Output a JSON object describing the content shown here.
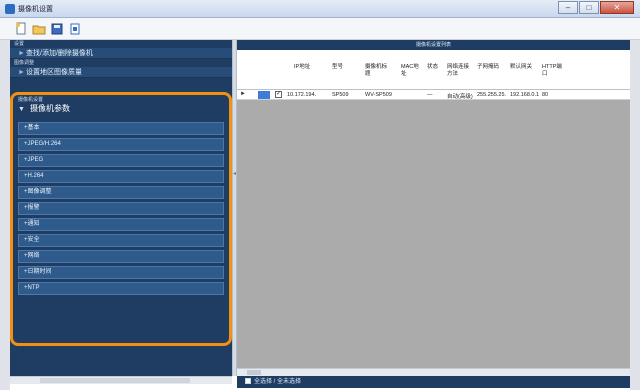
{
  "window": {
    "title": "摄像机设置",
    "min_glyph": "–",
    "max_glyph": "□",
    "close_glyph": "✕"
  },
  "toolbar": {
    "icons": [
      "new-icon",
      "open-icon",
      "save-icon",
      "export-icon"
    ]
  },
  "left": {
    "sections": [
      {
        "header": "设置",
        "row": "查找/添加/删除摄像机"
      },
      {
        "header": "图像调整",
        "row": "设置地区图像质量"
      }
    ],
    "camera_header": "摄像机设置",
    "camera_title": "摄像机参数",
    "params": [
      "+基本",
      "+JPEG/H.264",
      "+JPEG",
      "+H.264",
      "+图像调整",
      "+报警",
      "+通知",
      "+安全",
      "+网络",
      "+日期时间",
      "+NTP"
    ]
  },
  "right": {
    "panel_title": "摄像机设置列表",
    "columns": [
      "IP地址",
      "型号",
      "摄像机标题",
      "MAC地址",
      "状态",
      "网络连接方法",
      "子网掩码",
      "默认网关",
      "HTTP端口"
    ],
    "rows": [
      [
        "10.172.194.",
        "SP509",
        "WV-SP509",
        "",
        "—",
        "自动(高级)",
        "255.255.25.",
        "192.168.0.1",
        "80"
      ]
    ],
    "footer_label": "全选择 / 全未选择"
  },
  "colors": {
    "panel_dark": "#1f3d63",
    "highlight": "#f29111",
    "selection": "#3e7bd4"
  }
}
